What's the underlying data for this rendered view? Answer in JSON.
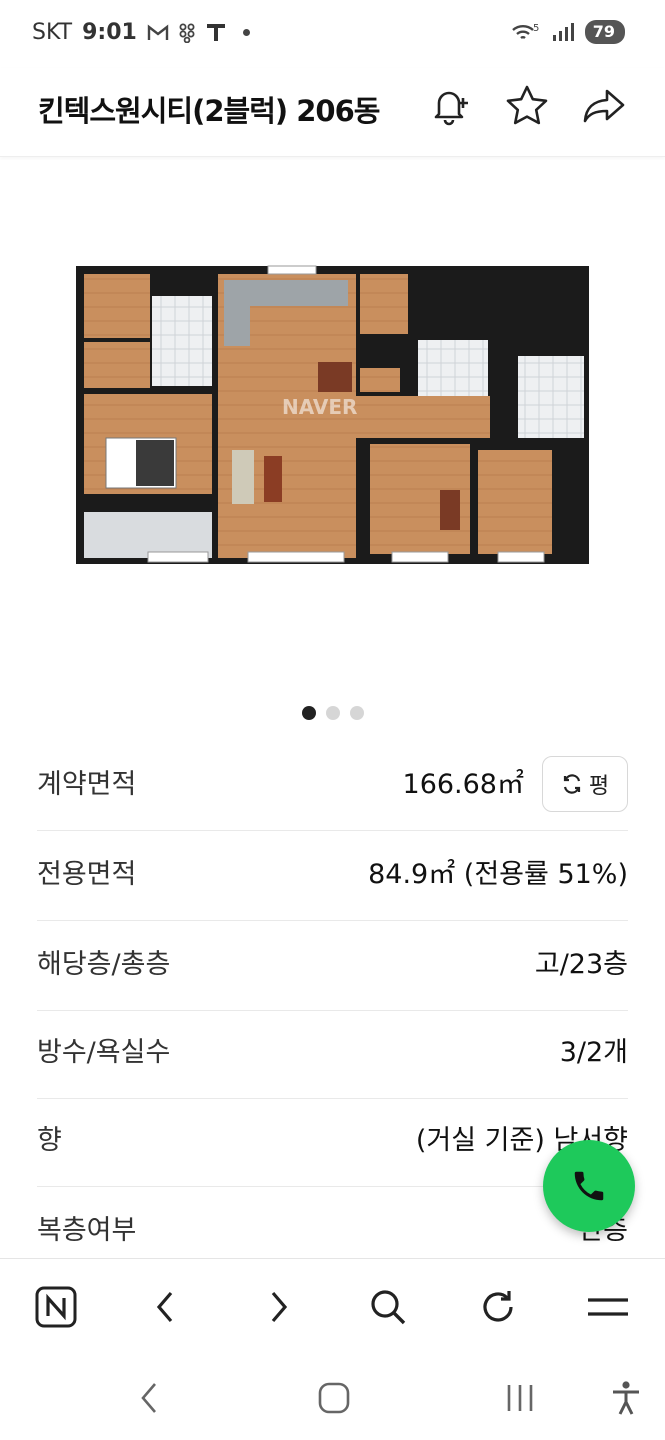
{
  "status_bar": {
    "carrier": "SKT",
    "time": "9:01",
    "icons_left": [
      "gmail-icon",
      "dots-grid-icon",
      "t-app-icon",
      "notification-dot"
    ],
    "icons_right": [
      "wifi-5g-icon",
      "signal-icon"
    ],
    "battery": "79"
  },
  "header": {
    "title": "킨텍스원시티(2블럭) 206동",
    "icons": [
      "bell-plus-icon",
      "star-icon",
      "share-icon"
    ]
  },
  "gallery": {
    "watermark": "NAVER",
    "page_count": 3,
    "active_index": 0
  },
  "info": {
    "contract_area_label": "계약면적",
    "contract_area_value": "166.68㎡",
    "unit_toggle_label": "평",
    "exclusive_area_label": "전용면적",
    "exclusive_area_value": "84.9㎡ (전용률 51%)",
    "floor_label": "해당층/총층",
    "floor_value": "고/23층",
    "rooms_label": "방수/욕실수",
    "rooms_value": "3/2개",
    "direction_label": "향",
    "direction_value": "(거실 기준) 남서향",
    "duplex_label": "복층여부",
    "duplex_value": "단층"
  },
  "colors": {
    "call_button": "#1ec95b",
    "floor_wood": "#c98f5e",
    "wall": "#1b1b1b"
  },
  "toolbar": {
    "icons": [
      "naver-home-icon",
      "back-icon",
      "forward-icon",
      "search-icon",
      "refresh-icon",
      "menu-icon"
    ]
  },
  "system_nav": {
    "icons": [
      "nav-back-icon",
      "nav-home-icon",
      "nav-recents-icon",
      "accessibility-icon"
    ]
  }
}
